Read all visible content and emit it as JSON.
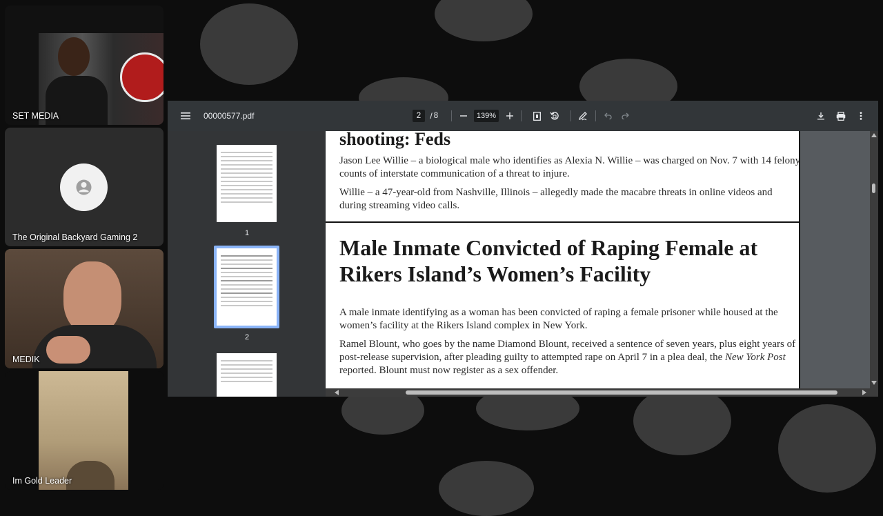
{
  "participants": [
    {
      "name": "SET MEDIA"
    },
    {
      "name": "The Original Backyard Gaming 2"
    },
    {
      "name": "MEDIK"
    },
    {
      "name": "Im Gold Leader"
    }
  ],
  "pdf": {
    "filename": "00000577.pdf",
    "current_page": "2",
    "page_separator": "/",
    "total_pages": "8",
    "zoom": "139%",
    "thumbnail_labels": [
      "1",
      "2"
    ]
  },
  "document": {
    "heading_1": "shooting: Feds",
    "paragraph_1": "Jason Lee Willie – a biological male who identifies as Alexia N. Willie – was charged on Nov. 7 with 14 felony counts of interstate communication of a threat to injure.",
    "paragraph_2": "Willie – a 47-year-old from Nashville, Illinois – allegedly made the macabre threats in online videos and during streaming video calls.",
    "heading_2_line_1": "Male Inmate Convicted of Raping Female at",
    "heading_2_line_2": "Rikers Island’s Women’s Facility",
    "paragraph_3": "A male inmate identifying as a woman has been convicted of raping a female prisoner while housed at the women’s facility at the Rikers Island complex in New York.",
    "paragraph_4_part_1": "Ramel Blount, who goes by the name Diamond Blount, received a sentence of seven years, plus eight years of post-release supervision, after pleading guilty to attempted rape on April 7 in a plea deal, the ",
    "paragraph_4_italic": "New York Post",
    "paragraph_4_part_2": " reported. Blount must now register as a sex offender."
  },
  "colors": {
    "app_background": "#0d0d0d",
    "blob": "#3a3a3a",
    "toolbar": "#323639",
    "selected_thumbnail_border": "#8ab4f8"
  }
}
